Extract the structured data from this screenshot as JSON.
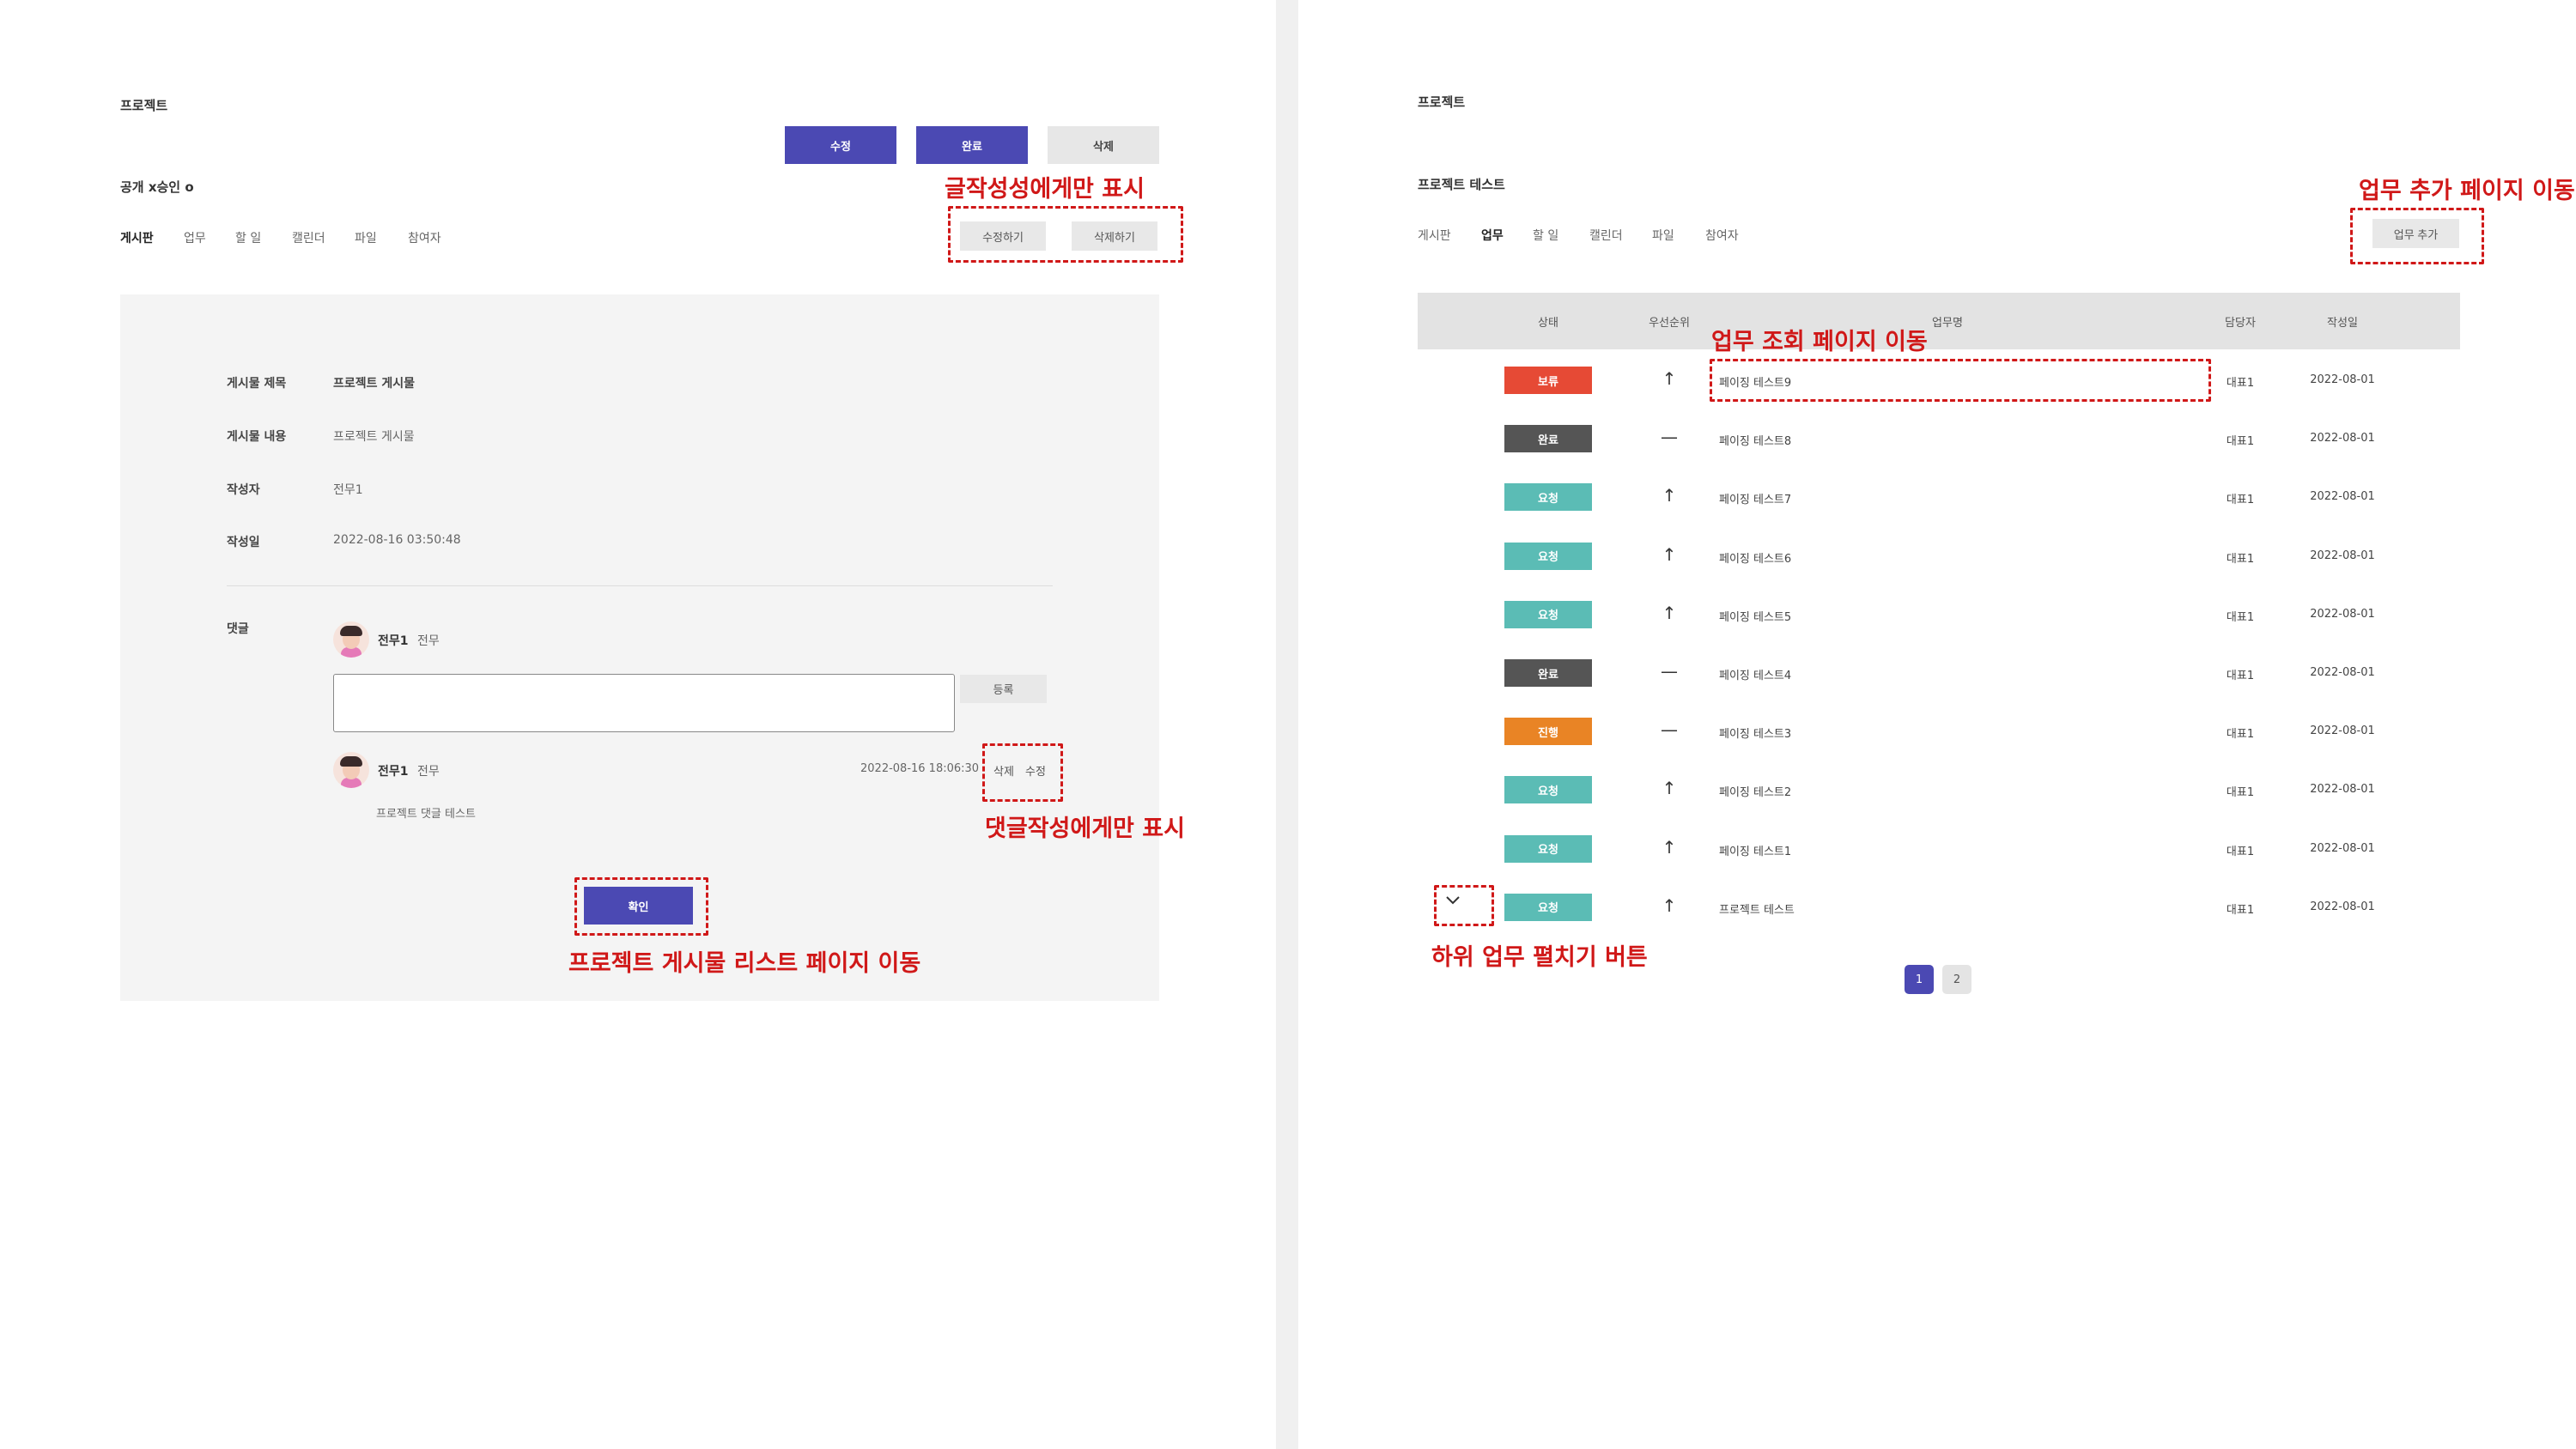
{
  "left": {
    "page_title": "프로젝트",
    "buttons": {
      "edit": "수정",
      "complete": "완료",
      "delete": "삭제"
    },
    "visibility": "공개 x승인 o",
    "tabs": [
      "게시판",
      "업무",
      "할 일",
      "캘린더",
      "파일",
      "참여자"
    ],
    "post_actions": {
      "edit": "수정하기",
      "delete": "삭제하기"
    },
    "post": {
      "title_label": "게시물 제목",
      "title_value": "프로젝트 게시물",
      "content_label": "게시물 내용",
      "content_value": "프로젝트 게시물",
      "author_label": "작성자",
      "author_value": "전무1",
      "date_label": "작성일",
      "date_value": "2022-08-16 03:50:48"
    },
    "comments": {
      "label": "댓글",
      "current_user": {
        "name": "전무1",
        "rank": "전무"
      },
      "register_button": "등록",
      "input_value": "",
      "items": [
        {
          "name": "전무1",
          "rank": "전무",
          "date": "2022-08-16 18:06:30",
          "delete": "삭제",
          "edit": "수정",
          "text": "프로젝트 댓글 테스트"
        }
      ]
    },
    "confirm_button": "확인"
  },
  "right": {
    "page_title": "프로젝트",
    "project_name": "프로젝트 테스트",
    "tabs": [
      "게시판",
      "업무",
      "할 일",
      "캘린더",
      "파일",
      "참여자"
    ],
    "add_task_button": "업무 추가",
    "table": {
      "headers": [
        "상태",
        "우선순위",
        "업무명",
        "담당자",
        "작성일"
      ],
      "rows": [
        {
          "status": "보류",
          "status_color": "#e64a35",
          "priority": "↑",
          "name": "페이징 테스트9",
          "assignee": "대표1",
          "date": "2022-08-01"
        },
        {
          "status": "완료",
          "status_color": "#555555",
          "priority": "—",
          "name": "페이징 테스트8",
          "assignee": "대표1",
          "date": "2022-08-01"
        },
        {
          "status": "요청",
          "status_color": "#5bbcb5",
          "priority": "↑",
          "name": "페이징 테스트7",
          "assignee": "대표1",
          "date": "2022-08-01"
        },
        {
          "status": "요청",
          "status_color": "#5bbcb5",
          "priority": "↑",
          "name": "페이징 테스트6",
          "assignee": "대표1",
          "date": "2022-08-01"
        },
        {
          "status": "요청",
          "status_color": "#5bbcb5",
          "priority": "↑",
          "name": "페이징 테스트5",
          "assignee": "대표1",
          "date": "2022-08-01"
        },
        {
          "status": "완료",
          "status_color": "#555555",
          "priority": "—",
          "name": "페이징 테스트4",
          "assignee": "대표1",
          "date": "2022-08-01"
        },
        {
          "status": "진행",
          "status_color": "#e98425",
          "priority": "—",
          "name": "페이징 테스트3",
          "assignee": "대표1",
          "date": "2022-08-01"
        },
        {
          "status": "요청",
          "status_color": "#5bbcb5",
          "priority": "↑",
          "name": "페이징 테스트2",
          "assignee": "대표1",
          "date": "2022-08-01"
        },
        {
          "status": "요청",
          "status_color": "#5bbcb5",
          "priority": "↑",
          "name": "페이징 테스트1",
          "assignee": "대표1",
          "date": "2022-08-01"
        },
        {
          "status": "요청",
          "status_color": "#5bbcb5",
          "priority": "↑",
          "name": "프로젝트 테스트",
          "assignee": "대표1",
          "date": "2022-08-01"
        }
      ]
    },
    "pagination": [
      "1",
      "2"
    ],
    "current_page": "1"
  },
  "annotations": {
    "post_author_only": "글작성성에게만 표시",
    "comment_author_only": "댓글작성에게만 표시",
    "go_to_list": "프로젝트 게시물 리스트 페이지 이동",
    "go_to_add_task": "업무 추가 페이지 이동",
    "go_to_task_view": "업무 조회 페이지 이동",
    "expand_subtasks": "하위 업무 펼치기 버튼"
  },
  "colors": {
    "primary": "#4b49b3",
    "annotation": "#d01818"
  }
}
